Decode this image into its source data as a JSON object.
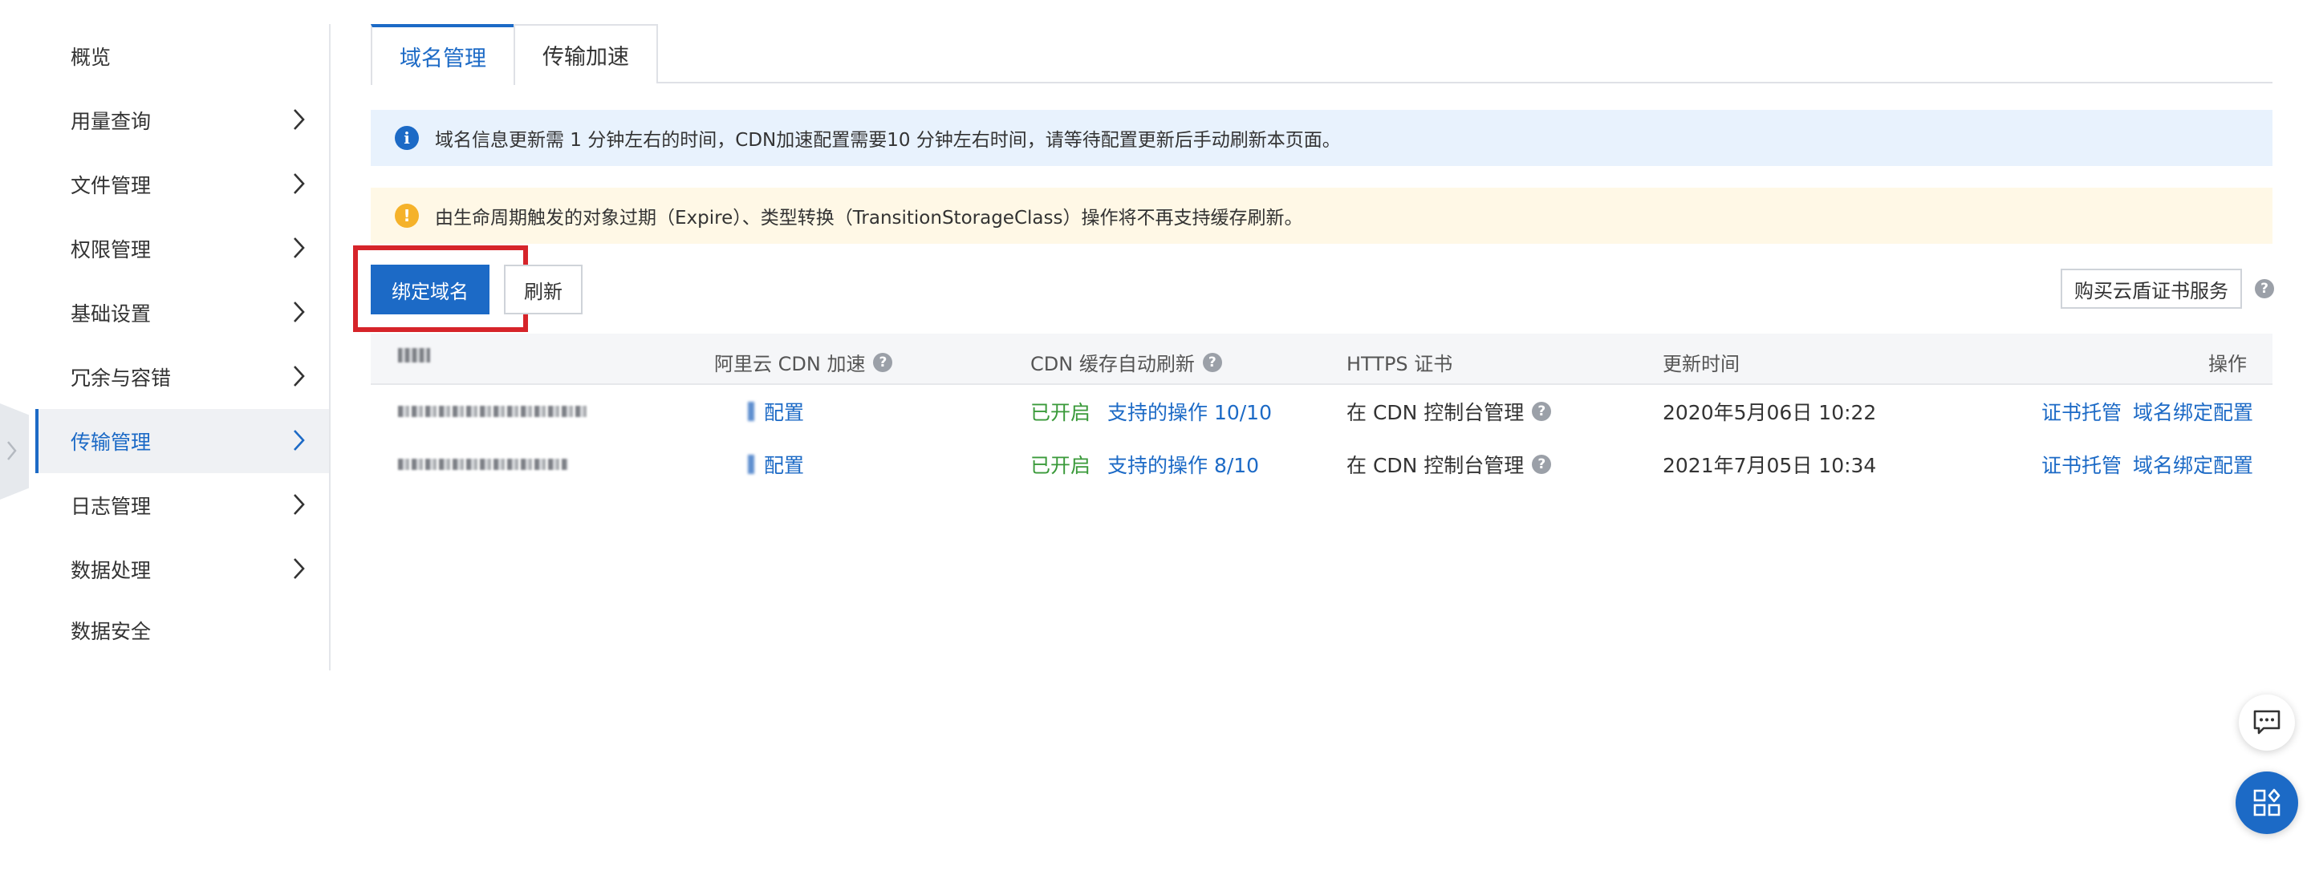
{
  "sidebar": {
    "items": [
      {
        "label": "概览",
        "has_arrow": false,
        "active": false
      },
      {
        "label": "用量查询",
        "has_arrow": true,
        "active": false
      },
      {
        "label": "文件管理",
        "has_arrow": true,
        "active": false
      },
      {
        "label": "权限管理",
        "has_arrow": true,
        "active": false
      },
      {
        "label": "基础设置",
        "has_arrow": true,
        "active": false
      },
      {
        "label": "冗余与容错",
        "has_arrow": true,
        "active": false
      },
      {
        "label": "传输管理",
        "has_arrow": true,
        "active": true
      },
      {
        "label": "日志管理",
        "has_arrow": true,
        "active": false
      },
      {
        "label": "数据处理",
        "has_arrow": true,
        "active": false
      },
      {
        "label": "数据安全",
        "has_arrow": false,
        "active": false
      }
    ]
  },
  "tabs": [
    {
      "label": "域名管理",
      "active": true
    },
    {
      "label": "传输加速",
      "active": false
    }
  ],
  "banners": {
    "info": {
      "icon": "i",
      "text": "域名信息更新需 1 分钟左右的时间，CDN加速配置需要10 分钟左右时间，请等待配置更新后手动刷新本页面。"
    },
    "warn": {
      "icon": "!",
      "text": "由生命周期触发的对象过期（Expire）、类型转换（TransitionStorageClass）操作将不再支持缓存刷新。"
    }
  },
  "toolbar": {
    "bind_label": "绑定域名",
    "refresh_label": "刷新",
    "buy_label": "购买云盾证书服务",
    "help_icon": "?"
  },
  "table": {
    "headers": {
      "domain": "",
      "cdn": "阿里云 CDN 加速",
      "refresh": "CDN 缓存自动刷新",
      "https": "HTTPS 证书",
      "updated": "更新时间",
      "actions": "操作"
    },
    "rows": [
      {
        "cdn_link": "配置",
        "status": "已开启",
        "ops_link": "支持的操作 10/10",
        "https": "在 CDN 控制台管理",
        "updated": "2020年5月06日 10:22",
        "action1": "证书托管",
        "action2": "域名绑定配置"
      },
      {
        "cdn_link": "配置",
        "status": "已开启",
        "ops_link": "支持的操作 8/10",
        "https": "在 CDN 控制台管理",
        "updated": "2021年7月05日 10:34",
        "action1": "证书托管",
        "action2": "域名绑定配置"
      }
    ]
  },
  "colors": {
    "primary": "#1c6ac6",
    "highlight_box": "#d6242a",
    "success": "#3a9a3a",
    "info_bg": "#e8f2fd",
    "warn_bg": "#fff8e6"
  },
  "icons": {
    "info": "info-circle-icon",
    "warn": "warning-circle-icon",
    "chat": "chat-bubble-icon",
    "apps": "apps-grid-icon",
    "chevron": "chevron-right-icon"
  }
}
